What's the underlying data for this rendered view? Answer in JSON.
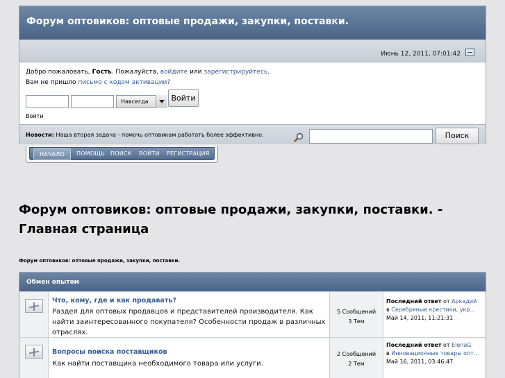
{
  "header": {
    "site_title": "Форум оптовиков: оптовые продажи, закупки, поставки.",
    "date": "Июнь 12, 2011, 07:01:42"
  },
  "login": {
    "welcome_prefix": "Добро пожаловать, ",
    "guest": "Гость",
    "welcome_mid": ". Пожалуйста, ",
    "login_link": "войдите",
    "or": " или ",
    "register_link": "зарегистрируйтесь",
    "period": ".",
    "no_email": "Вам не пришло ",
    "activation_link": "письмо с кодом активации?",
    "duration_selected": "Навсегда",
    "login_button": "Войти",
    "login_caption": "Войти"
  },
  "news": {
    "label": "Новости:",
    "text": " Наша вторая задача - помочь оптовикам работать более эффективно.",
    "search_button": "Поиск"
  },
  "menu": [
    "НАЧАЛО",
    "ПОМОЩЬ",
    "ПОИСК",
    "ВОЙТИ",
    "РЕГИСТРАЦИЯ"
  ],
  "page": {
    "title": "Форум оптовиков: оптовые продажи, закупки, поставки. - Главная страница",
    "breadcrumb": "Форум оптовиков: оптовые продажи, закупки, поставки."
  },
  "category": {
    "title": "Обмен опытом",
    "boards": [
      {
        "name": "Что, кому, где и как продавать?",
        "description": "Раздел для оптовых продавцов и представителей производителя. Как найти заинтересованного покупателя? Особенности продаж в различных отраслях.",
        "posts": "5 Сообщений",
        "topics": "3 Тем",
        "last_label": "Последний ответ",
        "from": " от ",
        "last_user": "Аркадий",
        "in": "в ",
        "last_topic": "Серебряные крестики, укр...",
        "last_date": "Май 14, 2011, 11:21:31"
      },
      {
        "name": "Вопросы поиска поставщиков",
        "description": "Как найти поставщика необходимого товара или услуги.",
        "posts": "2 Сообщений",
        "topics": "2 Тем",
        "last_label": "Последний ответ",
        "from": " от ",
        "last_user": "ElenaG",
        "in": "в ",
        "last_topic": "Инновационные товары опт...",
        "last_date": "Май 16, 2011, 03:46:47"
      }
    ]
  }
}
